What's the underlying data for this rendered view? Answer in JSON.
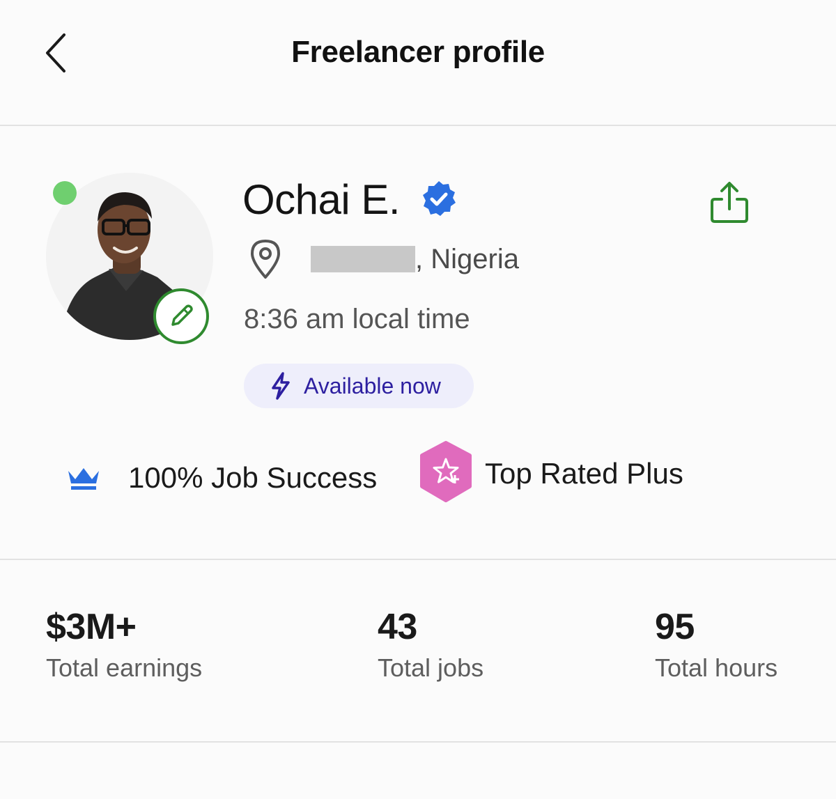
{
  "header": {
    "title": "Freelancer profile",
    "back_icon": "chevron-left-icon"
  },
  "profile": {
    "name": "Ochai E.",
    "verified_icon": "verified-badge-icon",
    "location_icon": "location-pin-icon",
    "location_suffix": ", Nigeria",
    "local_time": "8:36 am local time",
    "availability": "Available now",
    "availability_icon": "lightning-bolt-icon",
    "online_status_color": "#6fcf6f",
    "share_icon": "share-icon",
    "edit_icon": "pencil-icon"
  },
  "badges": {
    "job_success": "100% Job Success",
    "job_success_icon": "crown-icon",
    "top_rated": "Top Rated Plus",
    "top_rated_icon": "top-rated-plus-icon",
    "top_rated_color": "#e06bbd"
  },
  "stats": [
    {
      "value": "$3M+",
      "label": "Total earnings"
    },
    {
      "value": "43",
      "label": "Total jobs"
    },
    {
      "value": "95",
      "label": "Total hours"
    }
  ],
  "colors": {
    "accent_green": "#2f8a2f",
    "verified_blue": "#2b6fe0",
    "availability_text": "#2d1fa0",
    "availability_bg": "#eeeefb"
  }
}
